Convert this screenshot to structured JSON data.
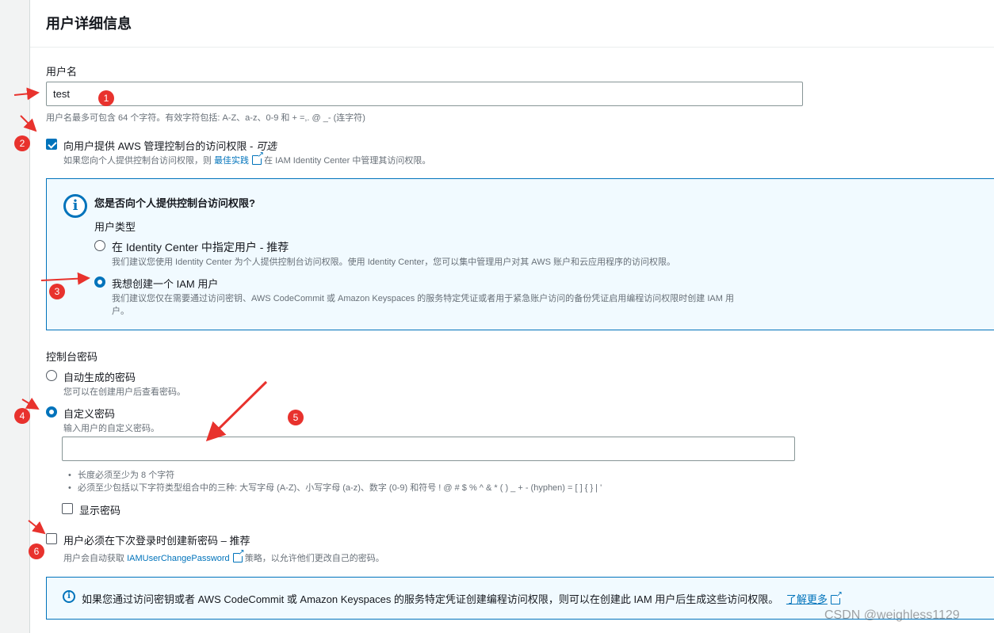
{
  "section": {
    "title": "用户详细信息"
  },
  "username": {
    "label": "用户名",
    "value": "test",
    "hint": "用户名最多可包含 64 个字符。有效字符包括: A-Z、a-z、0-9 和 + =,. @ _- (连字符)"
  },
  "console_access": {
    "label": "向用户提供 AWS 管理控制台的访问权限 - ",
    "optional": "可选",
    "hint_before": "如果您向个人提供控制台访问权限，则",
    "hint_link": "最佳实践",
    "hint_after": "在 IAM Identity Center 中管理其访问权限。",
    "checked": true
  },
  "info_box": {
    "question": "您是否向个人提供控制台访问权限?",
    "user_type_label": "用户类型",
    "options": [
      {
        "label": "在 Identity Center 中指定用户 - 推荐",
        "desc": "我们建议您使用 Identity Center 为个人提供控制台访问权限。使用 Identity Center，您可以集中管理用户对其 AWS 账户和云应用程序的访问权限。",
        "selected": false
      },
      {
        "label": "我想创建一个 IAM 用户",
        "desc_line1": "我们建议您仅在需要通过访问密钥、AWS CodeCommit 或 Amazon Keyspaces 的服务特定凭证或者用于紧急账户访问的备份凭证启用编程访问权限时创建 IAM 用",
        "desc_line2": "户。",
        "selected": true
      }
    ]
  },
  "password": {
    "label": "控制台密码",
    "options": [
      {
        "label": "自动生成的密码",
        "desc": "您可以在创建用户后查看密码。",
        "selected": false
      },
      {
        "label": "自定义密码",
        "desc": "输入用户的自定义密码。",
        "selected": true
      }
    ],
    "value": "",
    "rules": [
      "长度必须至少为 8 个字符",
      "必须至少包括以下字符类型组合中的三种: 大写字母 (A-Z)、小写字母 (a-z)、数字 (0-9) 和符号 ! @ # $ % ^ & * ( ) _ + - (hyphen) = [ ] { } | '"
    ],
    "show_password_label": "显示密码",
    "show_password_checked": false
  },
  "reset_password": {
    "label": "用户必须在下次登录时创建新密码 – 推荐",
    "hint_before": "用户会自动获取",
    "hint_link": "IAMUserChangePassword",
    "hint_after": "策略，以允许他们更改自己的密码。",
    "checked": false
  },
  "bottom_info": {
    "text": "如果您通过访问密钥或者 AWS CodeCommit 或 Amazon Keyspaces 的服务特定凭证创建编程访问权限，则可以在创建此 IAM 用户后生成这些访问权限。",
    "link": "了解更多"
  },
  "annotations": {
    "badges": [
      "1",
      "2",
      "3",
      "4",
      "5",
      "6"
    ]
  },
  "watermark": "CSDN @weighless1129",
  "colors": {
    "accent": "#0073bb",
    "annotation_red": "#e8322d",
    "info_bg": "#f1faff"
  }
}
